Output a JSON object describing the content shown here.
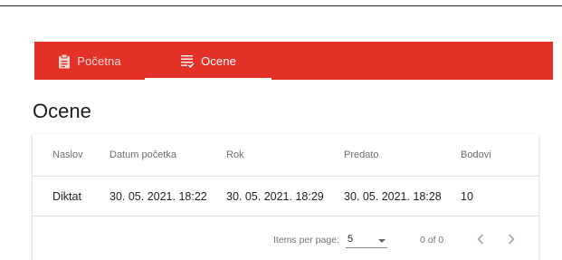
{
  "nav": {
    "tabs": [
      {
        "label": "Početna",
        "icon": "clipboard-icon"
      },
      {
        "label": "Ocene",
        "icon": "list-check-icon"
      }
    ],
    "active_tab": "Ocene",
    "colors": {
      "bar": "#e53228",
      "text": "#ffffff",
      "inactive_text": "#fbd7d3"
    }
  },
  "page": {
    "title": "Ocene"
  },
  "table": {
    "headers": [
      "Naslov",
      "Datum početka",
      "Rok",
      "Predato",
      "Bodovi"
    ],
    "rows": [
      [
        "Diktat",
        "30. 05. 2021. 18:22",
        "30. 05. 2021. 18:29",
        "30. 05. 2021. 18:28",
        "10"
      ]
    ]
  },
  "paginator": {
    "items_per_page_label": "Items per page:",
    "items_per_page_value": "5",
    "range_label": "0 of 0",
    "prev_icon": "chevron-left-icon",
    "next_icon": "chevron-right-icon"
  }
}
